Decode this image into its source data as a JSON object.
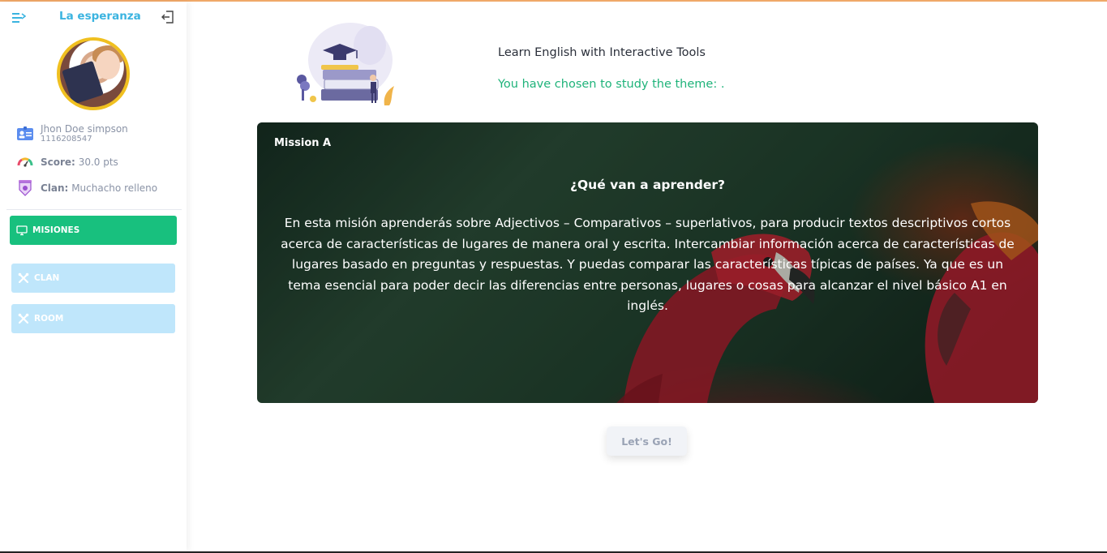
{
  "sidebar": {
    "brand": "La esperanza",
    "user": {
      "name": "Jhon Doe simpson",
      "id": "1116208547"
    },
    "score": {
      "label": "Score:",
      "value": "30.0 pts"
    },
    "clan": {
      "label": "Clan:",
      "value": "Muchacho relleno"
    },
    "nav": [
      {
        "label": "MISIONES",
        "icon": "monitor-icon",
        "active": true
      },
      {
        "label": "CLAN",
        "icon": "tools-icon",
        "active": false
      },
      {
        "label": "ROOM",
        "icon": "tools-icon",
        "active": false
      }
    ]
  },
  "hero": {
    "title": "Learn English with Interactive Tools",
    "subtitle": "You have chosen to study the theme: ."
  },
  "mission": {
    "label": "Mission A",
    "heading": "¿Qué van a aprender?",
    "body": "En esta misión aprenderás sobre Adjectivos – Comparativos – superlativos, para producir textos descriptivos cortos acerca de características de lugares de manera oral y escrita. Intercambiar información acerca de características de lugares basado en preguntas y respuestas. Y puedas comparar las características típicas de países. Ya que es un tema esencial para poder decir las diferencias entre personas, lugares o cosas para alcanzar el nivel básico A1 en inglés."
  },
  "action": {
    "go_label": "Let's Go!"
  },
  "colors": {
    "accent_green": "#18c07e",
    "brand_blue": "#3bb4e0",
    "nav_light": "#bfe6fb",
    "avatar_ring": "#f0c020"
  }
}
